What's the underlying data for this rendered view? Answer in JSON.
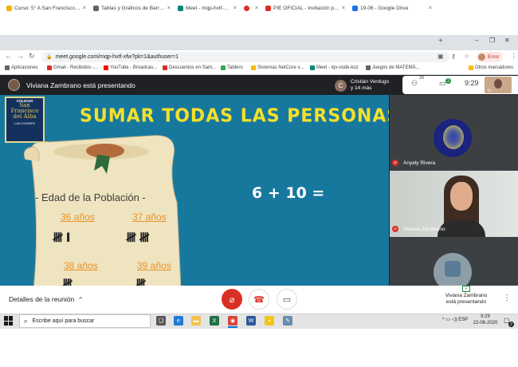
{
  "browser": {
    "tabs": [
      {
        "label": "Curso: 5° A San Francisco del A",
        "color": "#f4b400"
      },
      {
        "label": "Tablas y Graficos de Barra.pdf",
        "color": "#5f6368"
      },
      {
        "label": "Meet - mqp-hvtf-xfw",
        "color": "#00897b"
      },
      {
        "label": "",
        "color": "#d93025"
      },
      {
        "label": "PIE OFICIAL - Invitación para u",
        "color": "#d93025"
      },
      {
        "label": "19-06 - Google Drive",
        "color": "#1a73e8"
      }
    ],
    "new_tab": "+",
    "url": "meet.google.com/mqp-hvtf-xfw?pli=1&authuser=1",
    "profile_status": "Error",
    "bookmarks": [
      {
        "label": "Aplicaciones",
        "color": "#5f6368"
      },
      {
        "label": "Gmail - Recibidos -...",
        "color": "#d93025"
      },
      {
        "label": "YouTube - Broadcas...",
        "color": "#ff0000"
      },
      {
        "label": "Descuentos en Sant...",
        "color": "#d93025"
      },
      {
        "label": "Tablero",
        "color": "#34a853"
      },
      {
        "label": "Sistemas NetCore v...",
        "color": "#fbbc04"
      },
      {
        "label": "Meet - iqv-oodk-koz",
        "color": "#00897b"
      },
      {
        "label": "Juegos de MATEMÁ...",
        "color": "#5f6368"
      }
    ],
    "other_bookmarks": "Otros marcadores"
  },
  "meet": {
    "presenting_label": "Viviana Zambrano está presentando",
    "participants_chip": {
      "initial": "C",
      "line1": "Cristián Verdugo",
      "line2": "y 14 más"
    },
    "people_count": "20",
    "chat_count": "3",
    "clock": "9:29",
    "self_label": "Tú",
    "tiles": [
      {
        "name": "Anyely Rivera"
      },
      {
        "name": "Viviana Zambrano"
      },
      {
        "name": ""
      }
    ],
    "slide": {
      "title": "SUMAR TODAS LAS PERSONAS",
      "school": {
        "line1": "COLEGIO",
        "line2": "San Francisco del Alba",
        "line3": "LAS CONDES"
      },
      "heading": "- Edad de la Población -",
      "ages": [
        "36 años",
        "37 años",
        "38 años",
        "39 años"
      ],
      "tallies": [
        "𝍸 I",
        "𝍸 𝍸",
        "𝍸",
        "𝍸"
      ],
      "equation": "6 + 10 ="
    },
    "controls": {
      "meeting_details": "Detalles de la reunión",
      "presenting_status_line1": "Viviana Zambrano",
      "presenting_status_line2": "está presentando"
    }
  },
  "taskbar": {
    "search_placeholder": "Escribe aquí para buscar",
    "language": "ESP",
    "time": "9:29",
    "date": "22-06-2020",
    "notifications": "2"
  }
}
